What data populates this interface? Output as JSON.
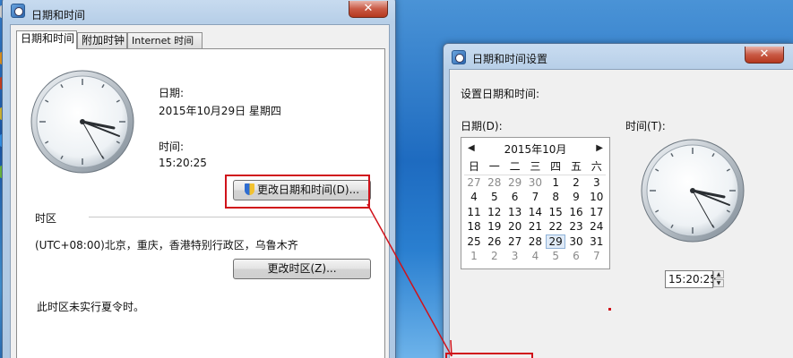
{
  "main_window": {
    "title": "日期和时间",
    "close_glyph": "✕",
    "tabs": [
      {
        "label": "日期和时间"
      },
      {
        "label": "附加时钟"
      },
      {
        "label": "Internet 时间"
      }
    ],
    "date_label": "日期:",
    "date_value": "2015年10月29日 星期四",
    "time_label": "时间:",
    "time_value": "15:20:25",
    "change_datetime_button": "更改日期和时间(D)...",
    "timezone_header": "时区",
    "timezone_value": "(UTC+08:00)北京，重庆，香港特别行政区，乌鲁木齐",
    "change_timezone_button": "更改时区(Z)...",
    "dst_note": "此时区未实行夏令时。"
  },
  "settings_window": {
    "title": "日期和时间设置",
    "close_glyph": "✕",
    "heading": "设置日期和时间:",
    "date_label": "日期(D):",
    "time_label": "时间(T):",
    "calendar": {
      "month_title": "2015年10月",
      "prev_glyph": "◀",
      "next_glyph": "▶",
      "weekdays": [
        "日",
        "一",
        "二",
        "三",
        "四",
        "五",
        "六"
      ],
      "weeks": [
        [
          "27",
          "28",
          "29",
          "30",
          "1",
          "2",
          "3"
        ],
        [
          "4",
          "5",
          "6",
          "7",
          "8",
          "9",
          "10"
        ],
        [
          "11",
          "12",
          "13",
          "14",
          "15",
          "16",
          "17"
        ],
        [
          "18",
          "19",
          "20",
          "21",
          "22",
          "23",
          "24"
        ],
        [
          "25",
          "26",
          "27",
          "28",
          "29",
          "30",
          "31"
        ],
        [
          "1",
          "2",
          "3",
          "4",
          "5",
          "6",
          "7"
        ]
      ],
      "selected_day": "29"
    },
    "time_value": "15:20:25",
    "spin_up": "▲",
    "spin_down": "▼"
  },
  "colors": {
    "annotation_red": "#d0121a",
    "selection_fill": "#dfeaf7"
  }
}
